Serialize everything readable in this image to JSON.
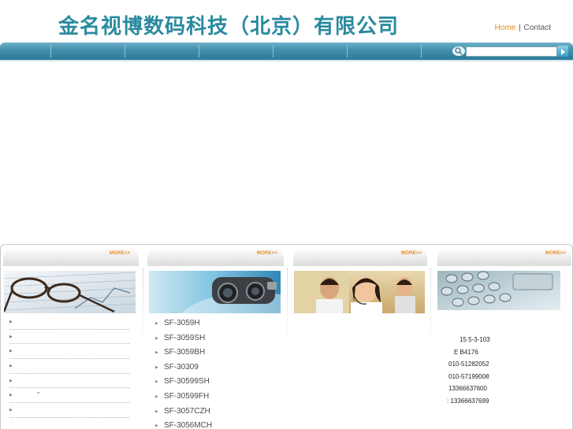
{
  "header": {
    "company_name": "金名视博数码科技（北京）有限公司",
    "links": {
      "home": "Home",
      "separator": "|",
      "contact": "Contact"
    }
  },
  "search": {
    "placeholder": ""
  },
  "columns": [
    {
      "more_label": "MORE>>",
      "icon": "glasses-document-photo"
    },
    {
      "more_label": "MORE>>",
      "icon": "cctv-camera-photo"
    },
    {
      "more_label": "MORE>>",
      "icon": "support-agents-photo"
    },
    {
      "more_label": "MORE>>",
      "icon": "phone-keypad-photo"
    }
  ],
  "news_list": [
    "",
    "",
    "",
    "",
    "",
    "\"",
    ""
  ],
  "products": [
    "SF-3059H",
    "SF-3059SH",
    "SF-3059BH",
    "SF-30309",
    "SF-30599SH",
    "SF-30599FH",
    "SF-3057CZH",
    "SF-3056MCH"
  ],
  "contact_info": [
    "15 5-3-103",
    "E  B4176",
    "010-51282052",
    "010-57199008",
    "13366637600",
    ": 13366637699"
  ]
}
